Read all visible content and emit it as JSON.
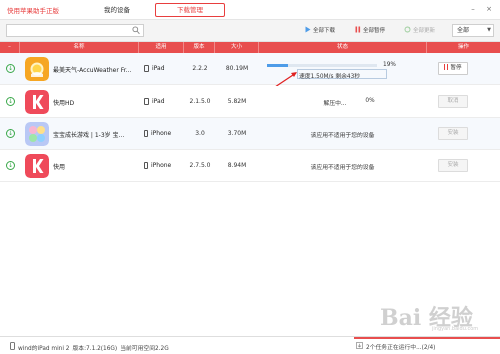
{
  "brand": "快用苹果助手正版",
  "nav": {
    "devices": "我的设备",
    "downloads": "下载管理"
  },
  "window_controls": {
    "minimize": "–",
    "close": "×"
  },
  "toolbar": {
    "search_placeholder": "",
    "download_all": "全部下载",
    "pause_all": "全部暂停",
    "update_all": "全部更新",
    "filter_value": "全部"
  },
  "table": {
    "headers": [
      "名称",
      "适用",
      "版本",
      "大小",
      "状态",
      "操作"
    ],
    "rows": [
      {
        "name": "最美天气-AccuWeather Fr...",
        "device": "iPad",
        "version": "2.2.2",
        "size": "80.19M",
        "status": "",
        "op": "暂停",
        "icon": "weather-app-icon"
      },
      {
        "name": "快用HD",
        "device": "iPad",
        "version": "2.1.5.0",
        "size": "5.82M",
        "status": "解压中...",
        "status_pct": "0%",
        "op": "取消",
        "icon": "kuaiyong-app-icon"
      },
      {
        "name": "宝宝成长游戏 | 1-3岁 宝...",
        "device": "iPhone",
        "version": "3.0",
        "size": "3.70M",
        "status": "该应用不适用于您的设备",
        "op": "安装",
        "icon": "baby-game-app-icon"
      },
      {
        "name": "快用",
        "device": "iPhone",
        "version": "2.7.5.0",
        "size": "8.94M",
        "status": "该应用不适用于您的设备",
        "op": "安装",
        "icon": "kuaiyong-app-icon"
      }
    ]
  },
  "download": {
    "progress_label": "19%",
    "progress_fraction": 0.19,
    "speed": "速度1.50M/s 剩余43秒"
  },
  "statusbar": {
    "device": "wind的iPad mini 2",
    "firmware": "版本:7.1.2(16G)",
    "space": "当前可用空间2.2G",
    "tasks": "2个任务正在运行中...(2/4)"
  },
  "watermark": {
    "text": "Bai 经验",
    "sub": "jingyan.baidu.com"
  },
  "colors": {
    "accent": "#e84e4e",
    "progress": "#4e9ce8",
    "download_green": "#3aa84a"
  }
}
